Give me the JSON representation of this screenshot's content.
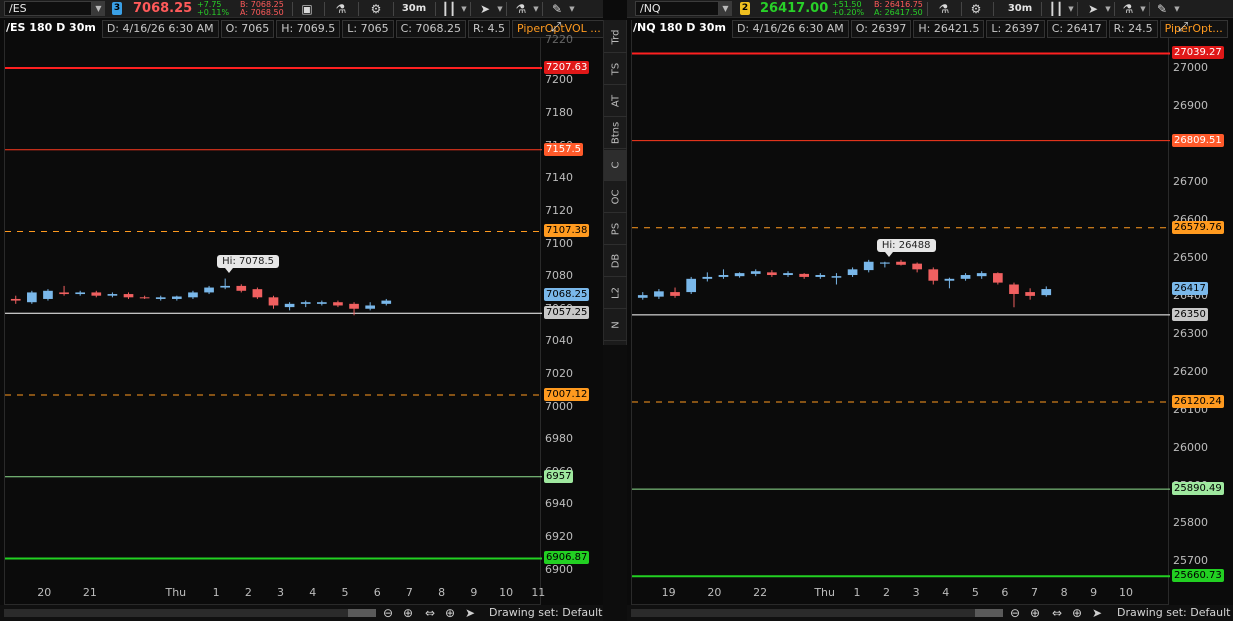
{
  "side_tabs": [
    {
      "label": "Trd",
      "active": false
    },
    {
      "label": "TS",
      "active": false
    },
    {
      "label": "AT",
      "active": false
    },
    {
      "label": "Btns",
      "active": false
    },
    {
      "label": "C",
      "active": true
    },
    {
      "label": "OC",
      "active": false
    },
    {
      "label": "PS",
      "active": false
    },
    {
      "label": "DB",
      "active": false
    },
    {
      "label": "L2",
      "active": false
    },
    {
      "label": "N",
      "active": false
    }
  ],
  "panels": [
    {
      "symbol": "/ES",
      "link_number": "3",
      "link_color": "#3aa0e6",
      "last": "7068.25",
      "last_color": "#ff5a5a",
      "change": "+7.75",
      "change_pct": "+0.11%",
      "bid": "B: 7068.25",
      "ask": "A: 7068.50",
      "aggregation": "30m",
      "header": {
        "title": "/ES 180 D 30m",
        "date": "D: 4/16/26 6:30 AM",
        "open": "O: 7065",
        "high": "H: 7069.5",
        "low": "L: 7065",
        "close": "C: 7068.25",
        "range": "R: 4.5",
        "study": "PiperOptVOL ..."
      },
      "axis": {
        "min": 6890,
        "max": 7226,
        "top_label": "7220",
        "ticks": [
          "7200",
          "7180",
          "7160",
          "7140",
          "7120",
          "7100",
          "7080",
          "7060",
          "7040",
          "7020",
          "7000",
          "6980",
          "6960",
          "6940",
          "6920",
          "6900"
        ]
      },
      "levels": [
        {
          "value": 7207.63,
          "label": "7207.63",
          "color": "#ff2020",
          "style": "solid",
          "width": 2,
          "text_color": "#ffffff",
          "bg": "#e01818"
        },
        {
          "value": 7157.5,
          "label": "7157.5",
          "color": "#ff3b1f",
          "style": "solid",
          "width": 1,
          "text_color": "#ffffff",
          "bg": "#ff5a2a"
        },
        {
          "value": 7107.38,
          "label": "7107.38",
          "color": "#ff9a1f",
          "style": "dashed",
          "width": 1,
          "text_color": "#000000",
          "bg": "#ff9a1f"
        },
        {
          "value": 7057.25,
          "label": "7057.25",
          "color": "#ffffff",
          "style": "solid",
          "width": 1,
          "text_color": "#000000",
          "bg": "#c8c8c8"
        },
        {
          "value": 7007.12,
          "label": "7007.12",
          "color": "#ff9a1f",
          "style": "dashed",
          "width": 1,
          "text_color": "#000000",
          "bg": "#ff9a1f"
        },
        {
          "value": 6957,
          "label": "6957",
          "color": "#8fe08f",
          "style": "solid",
          "width": 1,
          "text_color": "#000000",
          "bg": "#9fe89f"
        },
        {
          "value": 6906.87,
          "label": "6906.87",
          "color": "#22d022",
          "style": "solid",
          "width": 2,
          "text_color": "#000000",
          "bg": "#22d022"
        }
      ],
      "current_price": {
        "value": 7068.25,
        "label": "7068.25",
        "bg": "#7ab8ea"
      },
      "candles": [
        {
          "x": 0.02,
          "o": 7066,
          "h": 7068,
          "l": 7063,
          "c": 7065
        },
        {
          "x": 0.05,
          "o": 7064,
          "h": 7071,
          "l": 7063,
          "c": 7070
        },
        {
          "x": 0.08,
          "o": 7066,
          "h": 7072,
          "l": 7065,
          "c": 7071
        },
        {
          "x": 0.11,
          "o": 7070,
          "h": 7074,
          "l": 7068,
          "c": 7069
        },
        {
          "x": 0.14,
          "o": 7069,
          "h": 7071,
          "l": 7068,
          "c": 7070
        },
        {
          "x": 0.17,
          "o": 7070,
          "h": 7071,
          "l": 7067,
          "c": 7068
        },
        {
          "x": 0.2,
          "o": 7068,
          "h": 7070,
          "l": 7067,
          "c": 7069
        },
        {
          "x": 0.23,
          "o": 7069,
          "h": 7070,
          "l": 7066,
          "c": 7067
        },
        {
          "x": 0.26,
          "o": 7067,
          "h": 7068,
          "l": 7066,
          "c": 7066.5
        },
        {
          "x": 0.29,
          "o": 7066,
          "h": 7068,
          "l": 7065,
          "c": 7067
        },
        {
          "x": 0.32,
          "o": 7066,
          "h": 7068,
          "l": 7065,
          "c": 7067.5
        },
        {
          "x": 0.35,
          "o": 7067,
          "h": 7071,
          "l": 7066,
          "c": 7070
        },
        {
          "x": 0.38,
          "o": 7070,
          "h": 7074,
          "l": 7069,
          "c": 7073
        },
        {
          "x": 0.41,
          "o": 7073,
          "h": 7078.5,
          "l": 7072,
          "c": 7074
        },
        {
          "x": 0.44,
          "o": 7074,
          "h": 7075,
          "l": 7070,
          "c": 7071
        },
        {
          "x": 0.47,
          "o": 7072,
          "h": 7073,
          "l": 7066,
          "c": 7067
        },
        {
          "x": 0.5,
          "o": 7067,
          "h": 7068,
          "l": 7060,
          "c": 7062
        },
        {
          "x": 0.53,
          "o": 7061,
          "h": 7064,
          "l": 7059,
          "c": 7063
        },
        {
          "x": 0.56,
          "o": 7063,
          "h": 7065,
          "l": 7061,
          "c": 7064
        },
        {
          "x": 0.59,
          "o": 7063,
          "h": 7065,
          "l": 7062,
          "c": 7064
        },
        {
          "x": 0.62,
          "o": 7064,
          "h": 7065,
          "l": 7061,
          "c": 7062
        },
        {
          "x": 0.65,
          "o": 7063,
          "h": 7064,
          "l": 7056,
          "c": 7060
        },
        {
          "x": 0.68,
          "o": 7060,
          "h": 7064,
          "l": 7059,
          "c": 7062
        },
        {
          "x": 0.71,
          "o": 7063,
          "h": 7066,
          "l": 7062,
          "c": 7065
        }
      ],
      "hi_label": "Hi: 7078.5",
      "hi_value": 7078.5,
      "hi_x": 0.41,
      "time_labels": [
        {
          "x": 0.075,
          "label": "20"
        },
        {
          "x": 0.16,
          "label": "21"
        },
        {
          "x": 0.32,
          "label": "Thu"
        },
        {
          "x": 0.395,
          "label": "1"
        },
        {
          "x": 0.455,
          "label": "2"
        },
        {
          "x": 0.515,
          "label": "3"
        },
        {
          "x": 0.575,
          "label": "4"
        },
        {
          "x": 0.635,
          "label": "5"
        },
        {
          "x": 0.695,
          "label": "6"
        },
        {
          "x": 0.755,
          "label": "7"
        },
        {
          "x": 0.815,
          "label": "8"
        },
        {
          "x": 0.875,
          "label": "9"
        },
        {
          "x": 0.935,
          "label": "10"
        },
        {
          "x": 0.995,
          "label": "11"
        }
      ],
      "drawing_set": "Drawing set: Default"
    },
    {
      "symbol": "/NQ",
      "link_number": "2",
      "link_color": "#f0c020",
      "last": "26417.00",
      "last_color": "#28d028",
      "change": "+51.50",
      "change_pct": "+0.20%",
      "bid": "B: 26416.75",
      "ask": "A: 26417.50",
      "aggregation": "30m",
      "header": {
        "title": "/NQ 180 D 30m",
        "date": "D: 4/16/26 6:30 AM",
        "open": "O: 26397",
        "high": "H: 26421.5",
        "low": "L: 26397",
        "close": "C: 26417",
        "range": "R: 24.5",
        "study": "PiperOpt..."
      },
      "axis": {
        "min": 25635,
        "max": 27080,
        "top_label": "",
        "ticks": [
          "27000",
          "26900",
          "26800",
          "26700",
          "26600",
          "26500",
          "26400",
          "26300",
          "26200",
          "26100",
          "26000",
          "25900",
          "25800",
          "25700"
        ]
      },
      "levels": [
        {
          "value": 27039.27,
          "label": "27039.27",
          "color": "#ff2020",
          "style": "solid",
          "width": 2,
          "text_color": "#ffffff",
          "bg": "#e01818"
        },
        {
          "value": 26809.51,
          "label": "26809.51",
          "color": "#ff3b1f",
          "style": "solid",
          "width": 1,
          "text_color": "#ffffff",
          "bg": "#ff5a2a"
        },
        {
          "value": 26579.76,
          "label": "26579.76",
          "color": "#ff9a1f",
          "style": "dashed",
          "width": 1,
          "text_color": "#000000",
          "bg": "#ff9a1f"
        },
        {
          "value": 26350,
          "label": "26350",
          "color": "#ffffff",
          "style": "solid",
          "width": 1,
          "text_color": "#000000",
          "bg": "#c8c8c8"
        },
        {
          "value": 26120.24,
          "label": "26120.24",
          "color": "#ff9a1f",
          "style": "dashed",
          "width": 1,
          "text_color": "#000000",
          "bg": "#ff9a1f"
        },
        {
          "value": 25890.49,
          "label": "25890.49",
          "color": "#8fe08f",
          "style": "solid",
          "width": 1,
          "text_color": "#000000",
          "bg": "#9fe89f"
        },
        {
          "value": 25660.73,
          "label": "25660.73",
          "color": "#22d022",
          "style": "solid",
          "width": 2,
          "text_color": "#000000",
          "bg": "#22d022"
        }
      ],
      "current_price": {
        "value": 26417,
        "label": "26417",
        "bg": "#7ab8ea"
      },
      "candles": [
        {
          "x": 0.02,
          "o": 26395,
          "h": 26410,
          "l": 26390,
          "c": 26402
        },
        {
          "x": 0.05,
          "o": 26398,
          "h": 26418,
          "l": 26392,
          "c": 26412
        },
        {
          "x": 0.08,
          "o": 26410,
          "h": 26422,
          "l": 26395,
          "c": 26400
        },
        {
          "x": 0.11,
          "o": 26410,
          "h": 26450,
          "l": 26405,
          "c": 26445
        },
        {
          "x": 0.14,
          "o": 26445,
          "h": 26462,
          "l": 26438,
          "c": 26450
        },
        {
          "x": 0.17,
          "o": 26450,
          "h": 26470,
          "l": 26445,
          "c": 26455
        },
        {
          "x": 0.2,
          "o": 26452,
          "h": 26462,
          "l": 26448,
          "c": 26460
        },
        {
          "x": 0.23,
          "o": 26458,
          "h": 26470,
          "l": 26452,
          "c": 26465
        },
        {
          "x": 0.26,
          "o": 26462,
          "h": 26468,
          "l": 26450,
          "c": 26455
        },
        {
          "x": 0.29,
          "o": 26455,
          "h": 26465,
          "l": 26450,
          "c": 26460
        },
        {
          "x": 0.32,
          "o": 26458,
          "h": 26460,
          "l": 26445,
          "c": 26450
        },
        {
          "x": 0.35,
          "o": 26450,
          "h": 26460,
          "l": 26445,
          "c": 26455
        },
        {
          "x": 0.38,
          "o": 26448,
          "h": 26460,
          "l": 26430,
          "c": 26452
        },
        {
          "x": 0.41,
          "o": 26455,
          "h": 26475,
          "l": 26450,
          "c": 26470
        },
        {
          "x": 0.44,
          "o": 26468,
          "h": 26495,
          "l": 26462,
          "c": 26490
        },
        {
          "x": 0.47,
          "o": 26485,
          "h": 26490,
          "l": 26475,
          "c": 26488
        },
        {
          "x": 0.5,
          "o": 26490,
          "h": 26495,
          "l": 26480,
          "c": 26482
        },
        {
          "x": 0.53,
          "o": 26485,
          "h": 26488,
          "l": 26462,
          "c": 26470
        },
        {
          "x": 0.56,
          "o": 26470,
          "h": 26475,
          "l": 26430,
          "c": 26440
        },
        {
          "x": 0.59,
          "o": 26440,
          "h": 26448,
          "l": 26420,
          "c": 26445
        },
        {
          "x": 0.62,
          "o": 26445,
          "h": 26460,
          "l": 26440,
          "c": 26455
        },
        {
          "x": 0.65,
          "o": 26452,
          "h": 26465,
          "l": 26445,
          "c": 26460
        },
        {
          "x": 0.68,
          "o": 26460,
          "h": 26462,
          "l": 26430,
          "c": 26435
        },
        {
          "x": 0.71,
          "o": 26430,
          "h": 26435,
          "l": 26370,
          "c": 26405
        },
        {
          "x": 0.74,
          "o": 26410,
          "h": 26420,
          "l": 26390,
          "c": 26400
        },
        {
          "x": 0.77,
          "o": 26402,
          "h": 26425,
          "l": 26398,
          "c": 26418
        }
      ],
      "hi_label": "Hi: 26488",
      "hi_value": 26488,
      "hi_x": 0.47,
      "time_labels": [
        {
          "x": 0.07,
          "label": "19"
        },
        {
          "x": 0.155,
          "label": "20"
        },
        {
          "x": 0.24,
          "label": "22"
        },
        {
          "x": 0.36,
          "label": "Thu"
        },
        {
          "x": 0.42,
          "label": "1"
        },
        {
          "x": 0.475,
          "label": "2"
        },
        {
          "x": 0.53,
          "label": "3"
        },
        {
          "x": 0.585,
          "label": "4"
        },
        {
          "x": 0.64,
          "label": "5"
        },
        {
          "x": 0.695,
          "label": "6"
        },
        {
          "x": 0.75,
          "label": "7"
        },
        {
          "x": 0.805,
          "label": "8"
        },
        {
          "x": 0.86,
          "label": "9"
        },
        {
          "x": 0.92,
          "label": "10"
        }
      ],
      "drawing_set": "Drawing set: Default"
    }
  ],
  "colors": {
    "up": "#7ab8ea",
    "down": "#f06060",
    "bg": "#0b0b0b"
  }
}
